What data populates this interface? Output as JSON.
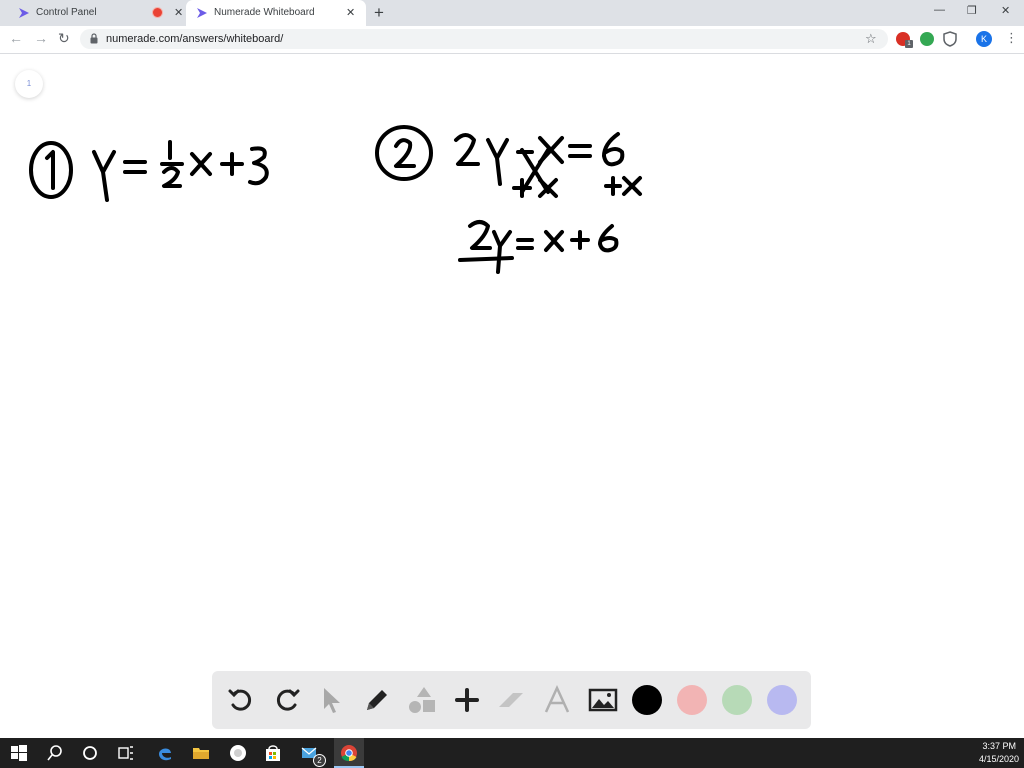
{
  "browser": {
    "tabs": [
      {
        "title": "Control Panel",
        "recording": true,
        "active": false
      },
      {
        "title": "Numerade Whiteboard",
        "active": true
      }
    ],
    "url": "numerade.com/answers/whiteboard/",
    "profile_initial": "K",
    "extension_badge": "1"
  },
  "whiteboard": {
    "page_number": "1",
    "problem1": {
      "label": "1",
      "equation": "y = 1/2 x + 3"
    },
    "problem2": {
      "label": "2",
      "equation": "2y - x = 6",
      "step": "+x  +x",
      "result": "2y = x + 6"
    }
  },
  "tools": [
    "undo-icon",
    "redo-icon",
    "pointer-icon",
    "pencil-icon",
    "shapes-icon",
    "plus-icon",
    "eraser-icon",
    "text-icon",
    "image-icon"
  ],
  "colors": {
    "black": "#000000",
    "red": "#f2b4b4",
    "green": "#b7dab7",
    "blue": "#b8b9f0",
    "accent": "#6c5ce7"
  },
  "taskbar": {
    "time": "3:37 PM",
    "date": "4/15/2020",
    "mail_badge": "2"
  }
}
